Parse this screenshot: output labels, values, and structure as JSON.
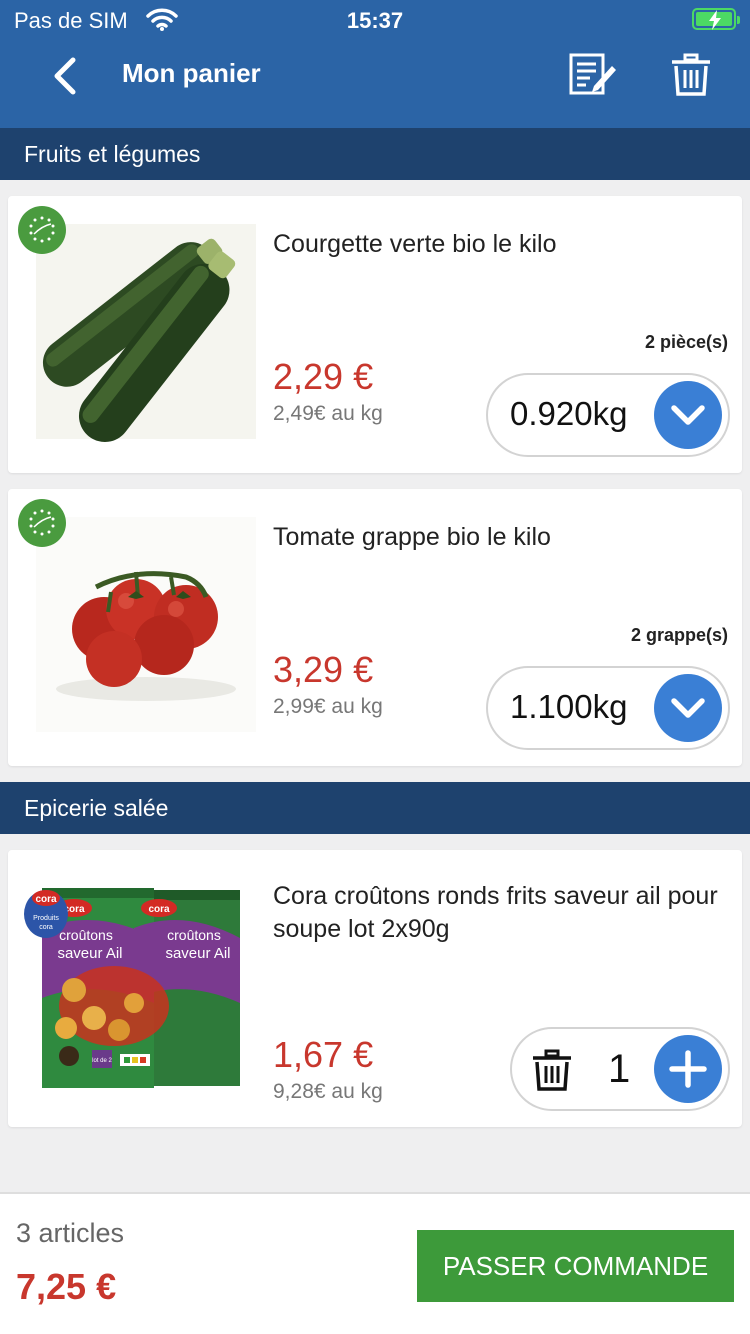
{
  "status_bar": {
    "carrier": "Pas de SIM",
    "time": "15:37"
  },
  "header": {
    "title": "Mon panier"
  },
  "sections": [
    {
      "title": "Fruits et légumes"
    },
    {
      "title": "Epicerie salée"
    }
  ],
  "products": [
    {
      "name": "Courgette verte bio le kilo",
      "price": "2,29 €",
      "unit_price": "2,49€ au kg",
      "pieces": "2 pièce(s)",
      "quantity": "0.920kg"
    },
    {
      "name": "Tomate grappe bio le kilo",
      "price": "3,29 €",
      "unit_price": "2,99€ au kg",
      "pieces": "2 grappe(s)",
      "quantity": "1.100kg"
    },
    {
      "name": "Cora croûtons ronds frits saveur ail pour soupe lot 2x90g",
      "price": "1,67 €",
      "unit_price": "9,28€ au kg",
      "quantity": "1",
      "package_text": {
        "brand": "cora",
        "brand_badge": "Produits",
        "product": "croûtons",
        "flavor": "saveur Ail",
        "lot": "lot de 2"
      }
    }
  ],
  "footer": {
    "count": "3 articles",
    "total": "7,25 €",
    "order_button": "PASSER COMMANDE"
  },
  "colors": {
    "header_bg": "#2b64a6",
    "section_bg": "#1e426e",
    "price": "#c8372d",
    "accent": "#3a7fd5",
    "order_button": "#3d9a3a"
  }
}
